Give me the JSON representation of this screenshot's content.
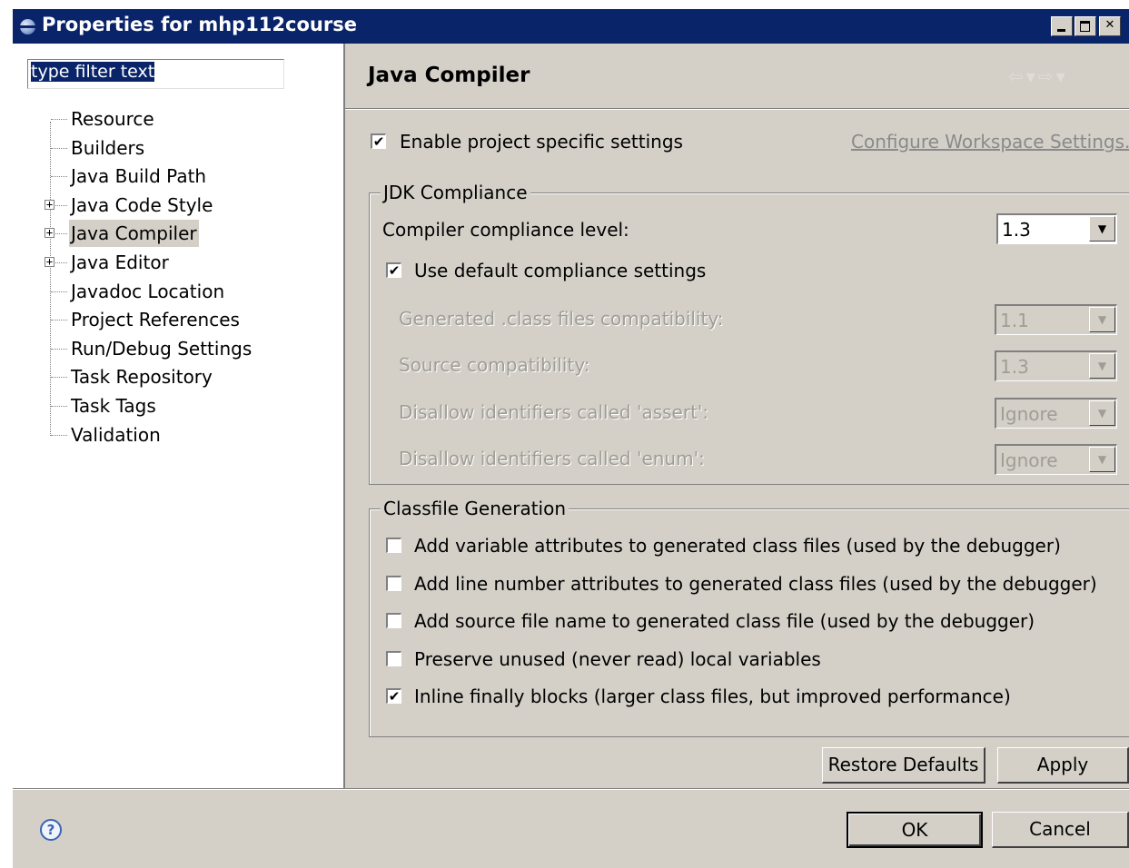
{
  "window": {
    "title": "Properties for mhp112course"
  },
  "filter": {
    "value": "type filter text"
  },
  "tree": [
    {
      "label": "Resource",
      "expandable": false
    },
    {
      "label": "Builders",
      "expandable": false
    },
    {
      "label": "Java Build Path",
      "expandable": false
    },
    {
      "label": "Java Code Style",
      "expandable": true
    },
    {
      "label": "Java Compiler",
      "expandable": true,
      "selected": true
    },
    {
      "label": "Java Editor",
      "expandable": true
    },
    {
      "label": "Javadoc Location",
      "expandable": false
    },
    {
      "label": "Project References",
      "expandable": false
    },
    {
      "label": "Run/Debug Settings",
      "expandable": false
    },
    {
      "label": "Task Repository",
      "expandable": false
    },
    {
      "label": "Task Tags",
      "expandable": false
    },
    {
      "label": "Validation",
      "expandable": false
    }
  ],
  "page": {
    "title": "Java Compiler",
    "nav_icons": [
      "back-arrow-icon",
      "dropdown-icon",
      "forward-arrow-icon",
      "dropdown-icon"
    ],
    "enable_specific": {
      "label": "Enable project specific settings",
      "checked": true
    },
    "configure_link": "Configure Workspace Settings...",
    "jdk": {
      "title": "JDK Compliance",
      "compliance_label": "Compiler compliance level:",
      "compliance_value": "1.3",
      "use_default": {
        "label": "Use default compliance settings",
        "checked": true
      },
      "rows": [
        {
          "label": "Generated .class files compatibility:",
          "value": "1.1"
        },
        {
          "label": "Source compatibility:",
          "value": "1.3"
        },
        {
          "label": "Disallow identifiers called 'assert':",
          "value": "Ignore"
        },
        {
          "label": "Disallow identifiers called 'enum':",
          "value": "Ignore"
        }
      ]
    },
    "classfile": {
      "title": "Classfile Generation",
      "options": [
        {
          "label": "Add variable attributes to generated class files (used by the debugger)",
          "checked": false
        },
        {
          "label": "Add line number attributes to generated class files (used by the debugger)",
          "checked": false
        },
        {
          "label": "Add source file name to generated class file (used by the debugger)",
          "checked": false
        },
        {
          "label": "Preserve unused (never read) local variables",
          "checked": false
        },
        {
          "label": "Inline finally blocks (larger class files, but improved performance)",
          "checked": true
        }
      ]
    },
    "restore_defaults": "Restore Defaults",
    "apply": "Apply"
  },
  "footer": {
    "ok": "OK",
    "cancel": "Cancel"
  },
  "checkmark": "✔"
}
